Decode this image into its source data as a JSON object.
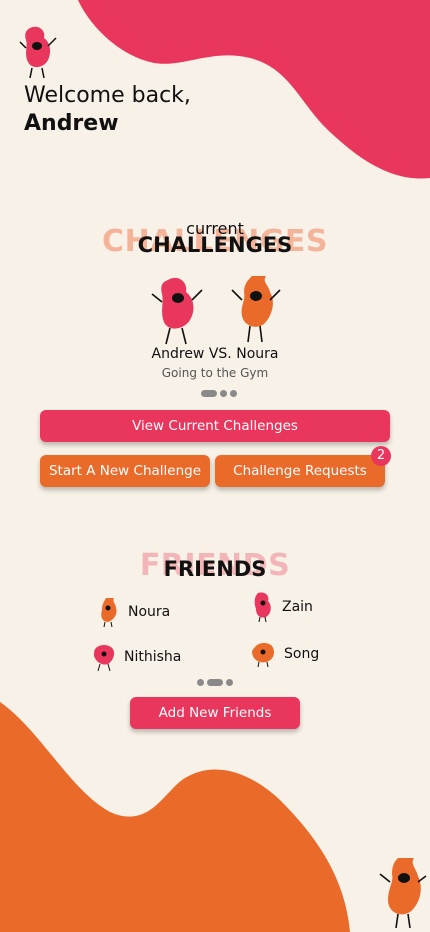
{
  "header": {
    "greeting": "Welcome back,",
    "user_name": "Andrew"
  },
  "challenges": {
    "kicker": "current",
    "ghost_title": "CHALLENGES",
    "title": "CHALLENGES",
    "player_one": "Andrew",
    "vs": "VS.",
    "player_two": "Noura",
    "activity": "Going to the Gym",
    "view_button": "View Current Challenges",
    "new_button": "Start A New Challenge",
    "requests_button": "Challenge Requests",
    "requests_count": "2"
  },
  "friends": {
    "ghost_title": "FRIENDS",
    "title": "FRIENDS",
    "list": [
      {
        "name": "Noura"
      },
      {
        "name": "Zain"
      },
      {
        "name": "Nithisha"
      },
      {
        "name": "Song"
      }
    ],
    "add_button": "Add New Friends"
  },
  "colors": {
    "background": "#f7f1e7",
    "pink": "#e8365c",
    "orange": "#ea6a2a",
    "ghost": "#f4b49a"
  },
  "icons": {
    "mascot": "bean-mascot-icon"
  }
}
